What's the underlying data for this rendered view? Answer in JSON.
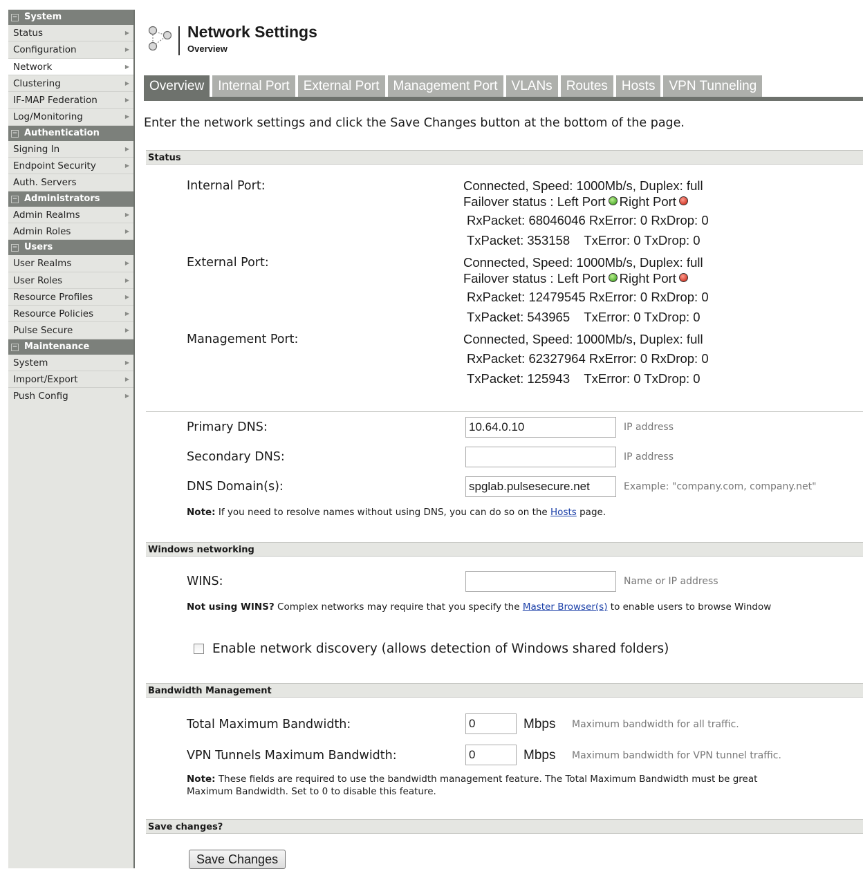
{
  "sidebar": {
    "sections": [
      {
        "title": "System",
        "items": [
          "Status",
          "Configuration",
          "Network",
          "Clustering",
          "IF-MAP Federation",
          "Log/Monitoring"
        ]
      },
      {
        "title": "Authentication",
        "items": [
          "Signing In",
          "Endpoint Security",
          "Auth. Servers"
        ]
      },
      {
        "title": "Administrators",
        "items": [
          "Admin Realms",
          "Admin Roles"
        ]
      },
      {
        "title": "Users",
        "items": [
          "User Realms",
          "User Roles",
          "Resource Profiles",
          "Resource Policies",
          "Pulse Secure"
        ]
      },
      {
        "title": "Maintenance",
        "items": [
          "System",
          "Import/Export",
          "Push Config"
        ]
      }
    ],
    "active_item": "Network"
  },
  "header": {
    "title": "Network Settings",
    "subtitle": "Overview"
  },
  "tabs": [
    "Overview",
    "Internal Port",
    "External Port",
    "Management Port",
    "VLANs",
    "Routes",
    "Hosts",
    "VPN Tunneling"
  ],
  "active_tab": "Overview",
  "intro": "Enter the network settings and click the Save Changes button at the bottom of the page.",
  "status": {
    "heading": "Status",
    "internal": {
      "label": "Internal Port:",
      "connection": "Connected, Speed: 1000Mb/s, Duplex: full",
      "failover_prefix": "Failover status : Left Port",
      "failover_right": "Right Port",
      "rx": "RxPacket: 68046046 RxError: 0 RxDrop: 0",
      "tx": "TxPacket: 353158    TxError: 0 TxDrop: 0"
    },
    "external": {
      "label": "External Port:",
      "connection": "Connected, Speed: 1000Mb/s, Duplex: full",
      "failover_prefix": "Failover status : Left Port",
      "failover_right": "Right Port",
      "rx": "RxPacket: 12479545 RxError: 0 RxDrop: 0",
      "tx": "TxPacket: 543965    TxError: 0 TxDrop: 0"
    },
    "management": {
      "label": "Management Port:",
      "connection": "Connected, Speed: 1000Mb/s, Duplex: full",
      "rx": "RxPacket: 62327964 RxError: 0 RxDrop: 0",
      "tx": "TxPacket: 125943    TxError: 0 TxDrop: 0"
    },
    "left_port_color": "#2f9a12",
    "right_port_color": "#c31a0a"
  },
  "dns": {
    "primary_label": "Primary DNS:",
    "primary_value": "10.64.0.10",
    "primary_hint": "IP address",
    "secondary_label": "Secondary DNS:",
    "secondary_value": "",
    "secondary_hint": "IP address",
    "domain_label": "DNS Domain(s):",
    "domain_value": "spglab.pulsesecure.net",
    "domain_hint": "Example: \"company.com, company.net\"",
    "note_bold": "Note:",
    "note_text": " If you need to resolve names without using DNS, you can do so on the ",
    "note_link": "Hosts",
    "note_end": " page."
  },
  "windows": {
    "heading": "Windows networking",
    "wins_label": "WINS:",
    "wins_value": "",
    "wins_hint": "Name or IP address",
    "note_bold": "Not using WINS?",
    "note_text": " Complex networks may require that you specify the ",
    "note_link": "Master Browser(s)",
    "note_end": " to enable users to browse Window",
    "discovery_label": "Enable network discovery (allows detection of Windows shared folders)",
    "discovery_checked": false
  },
  "bandwidth": {
    "heading": "Bandwidth Management",
    "total_label": "Total Maximum Bandwidth:",
    "total_value": "0",
    "total_unit": "Mbps",
    "total_hint": "Maximum bandwidth for all traffic.",
    "vpn_label": "VPN Tunnels Maximum Bandwidth:",
    "vpn_value": "0",
    "vpn_unit": "Mbps",
    "vpn_hint": "Maximum bandwidth for VPN tunnel traffic.",
    "note_bold": "Note:",
    "note_line1": " These fields are required to use the bandwidth management feature. The Total Maximum Bandwidth must be great",
    "note_line2": "Maximum Bandwidth. Set to 0 to disable this feature."
  },
  "save": {
    "heading": "Save changes?",
    "button": "Save Changes"
  }
}
